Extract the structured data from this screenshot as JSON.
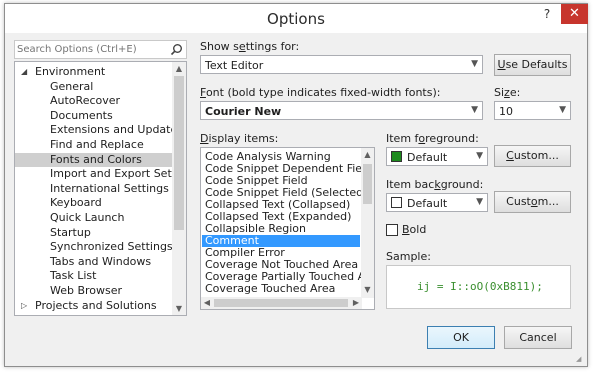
{
  "window": {
    "title": "Options",
    "help_icon": "?",
    "close_icon": "✕"
  },
  "search": {
    "placeholder": "Search Options (Ctrl+E)",
    "icon": "search-icon"
  },
  "tree": {
    "items": [
      {
        "label": "Environment",
        "expanded": true,
        "level": 0
      },
      {
        "label": "General",
        "level": 1
      },
      {
        "label": "AutoRecover",
        "level": 1
      },
      {
        "label": "Documents",
        "level": 1
      },
      {
        "label": "Extensions and Updates",
        "level": 1
      },
      {
        "label": "Find and Replace",
        "level": 1
      },
      {
        "label": "Fonts and Colors",
        "level": 1,
        "selected": true
      },
      {
        "label": "Import and Export Settings",
        "level": 1
      },
      {
        "label": "International Settings",
        "level": 1
      },
      {
        "label": "Keyboard",
        "level": 1
      },
      {
        "label": "Quick Launch",
        "level": 1
      },
      {
        "label": "Startup",
        "level": 1
      },
      {
        "label": "Synchronized Settings",
        "level": 1
      },
      {
        "label": "Tabs and Windows",
        "level": 1
      },
      {
        "label": "Task List",
        "level": 1
      },
      {
        "label": "Web Browser",
        "level": 1
      },
      {
        "label": "Projects and Solutions",
        "expanded": false,
        "level": 0
      }
    ]
  },
  "show_settings": {
    "label_pre": "Show s",
    "label_u": "e",
    "label_post": "ttings for:",
    "value": "Text Editor"
  },
  "use_defaults": {
    "label_u": "U",
    "label_rest": "se Defaults"
  },
  "font": {
    "label_u": "F",
    "label_rest": "ont (bold type indicates fixed-width fonts):",
    "value": "Courier New"
  },
  "size": {
    "label_pre": "Si",
    "label_u": "z",
    "label_post": "e:",
    "value": "10"
  },
  "display_items": {
    "label_u": "D",
    "label_rest": "isplay items:",
    "items": [
      "Code Analysis Warning",
      "Code Snippet Dependent Field",
      "Code Snippet Field",
      "Code Snippet Field (Selected)",
      "Collapsed Text (Collapsed)",
      "Collapsed Text (Expanded)",
      "Collapsible Region",
      "Comment",
      "Compiler Error",
      "Coverage Not Touched Area",
      "Coverage Partially Touched Area",
      "Coverage Touched Area"
    ],
    "selected_index": 7
  },
  "item_foreground": {
    "label_pre": "Item f",
    "label_u": "o",
    "label_post": "reground:",
    "value": "Default",
    "swatch_color": "#1e8a1e",
    "custom_pre": "",
    "custom_u": "C",
    "custom_post": "ustom..."
  },
  "item_background": {
    "label_pre": "Item bac",
    "label_u": "k",
    "label_post": "ground:",
    "value": "Default",
    "swatch_color": "#ffffff",
    "custom_pre": "Cust",
    "custom_u": "o",
    "custom_post": "m..."
  },
  "bold": {
    "label_u": "B",
    "label_rest": "old",
    "checked": false
  },
  "sample": {
    "label": "Sample:",
    "text": "ij = I::oO(0xB811);"
  },
  "ok_label": "OK",
  "cancel_label": "Cancel",
  "colors": {
    "selection": "#3399ff",
    "tree_selection": "#cfcfcf",
    "close_button": "#c7352d",
    "sample_text": "#3a8f2f"
  }
}
